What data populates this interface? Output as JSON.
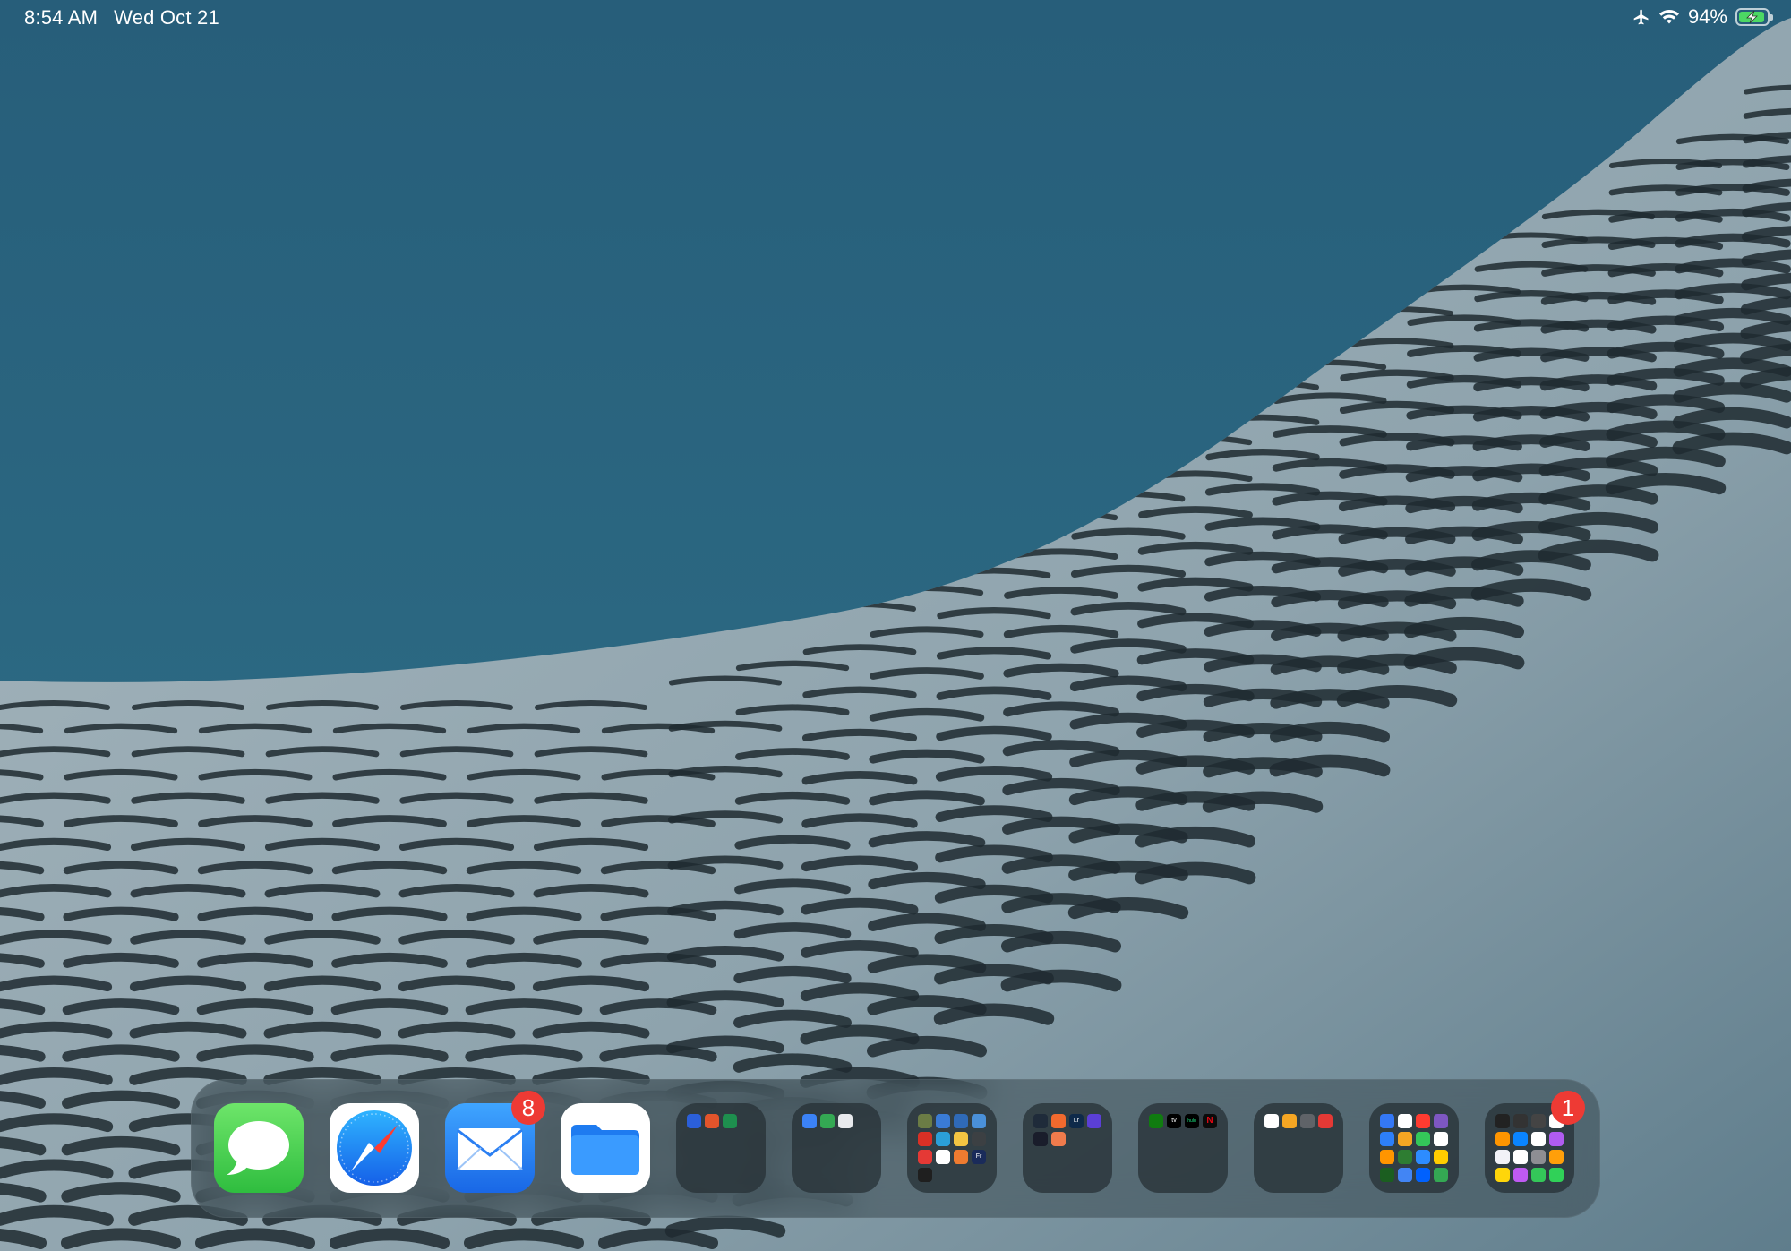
{
  "status_bar": {
    "time": "8:54 AM",
    "date": "Wed Oct 21",
    "battery_percent": "94%",
    "battery_level": 0.94,
    "airplane_icon": "airplane-icon",
    "wifi_icon": "wifi-icon",
    "battery_icon": "battery-charging-icon"
  },
  "dock": {
    "apps": [
      {
        "name": "messages",
        "icon": "messages-icon"
      },
      {
        "name": "safari",
        "icon": "safari-compass-icon"
      },
      {
        "name": "mail",
        "icon": "mail-envelope-icon",
        "badge": "8"
      },
      {
        "name": "files",
        "icon": "files-folder-icon"
      }
    ],
    "folders": [
      {
        "name": "folder-1",
        "mini": [
          {
            "color": "#2b5fd9"
          },
          {
            "color": "#e2542b"
          },
          {
            "color": "#1e8f4e"
          }
        ]
      },
      {
        "name": "folder-2",
        "mini": [
          {
            "color": "#3b82f6"
          },
          {
            "color": "#34a853"
          },
          {
            "color": "#e8eaed"
          }
        ]
      },
      {
        "name": "folder-3",
        "mini": [
          {
            "color": "#6b7c45"
          },
          {
            "color": "#3a7bd5"
          },
          {
            "color": "#2f6ab8"
          },
          {
            "color": "#4a90d9"
          },
          {
            "color": "#d93025"
          },
          {
            "color": "#2b9fd8"
          },
          {
            "color": "#f4c542"
          },
          {
            "color": "#3c4043"
          },
          {
            "color": "#e53935"
          },
          {
            "color": "#ffffff"
          },
          {
            "color": "#ee7b30"
          },
          {
            "color": "#1a2b5a",
            "label": "Fr"
          },
          {
            "color": "#1f1f1f"
          }
        ]
      },
      {
        "name": "folder-4",
        "mini": [
          {
            "color": "#1f2b3a"
          },
          {
            "color": "#f26a2e"
          },
          {
            "color": "#0e2a4a",
            "label": "Lr"
          },
          {
            "color": "#5b3fd6"
          },
          {
            "color": "#1a1d2b"
          },
          {
            "color": "#f07b4c"
          }
        ]
      },
      {
        "name": "folder-5",
        "mini": [
          {
            "color": "#107c10"
          },
          {
            "color": "#000000",
            "label": "tv"
          },
          {
            "color": "#000000",
            "label": "hulu"
          },
          {
            "color": "#0b0b0b",
            "label": "N"
          }
        ]
      },
      {
        "name": "folder-6",
        "mini": [
          {
            "color": "#ffffff"
          },
          {
            "color": "#f5a623"
          },
          {
            "color": "#5f6368"
          },
          {
            "color": "#e53935"
          }
        ]
      },
      {
        "name": "folder-7",
        "mini": [
          {
            "color": "#3478f6"
          },
          {
            "color": "#ffffff"
          },
          {
            "color": "#ff3b30"
          },
          {
            "color": "#7e57c2"
          },
          {
            "color": "#2d7ff9"
          },
          {
            "color": "#f5a623"
          },
          {
            "color": "#34c759"
          },
          {
            "color": "#ffffff"
          },
          {
            "color": "#ff9500"
          },
          {
            "color": "#2e7d32"
          },
          {
            "color": "#2d8cff"
          },
          {
            "color": "#ffcc00"
          },
          {
            "color": "#1b5e20"
          },
          {
            "color": "#4285f4"
          },
          {
            "color": "#0061fe"
          },
          {
            "color": "#34a853"
          }
        ]
      },
      {
        "name": "folder-8",
        "badge": "1",
        "mini": [
          {
            "color": "#222222"
          },
          {
            "color": "#333333"
          },
          {
            "color": "#444444"
          },
          {
            "color": "#ffffff"
          },
          {
            "color": "#ff9500"
          },
          {
            "color": "#0a84ff"
          },
          {
            "color": "#ffffff"
          },
          {
            "color": "#b05cf0"
          },
          {
            "color": "#f2f2f7"
          },
          {
            "color": "#ffffff"
          },
          {
            "color": "#8e8e93"
          },
          {
            "color": "#ff9f0a"
          },
          {
            "color": "#ffd60a"
          },
          {
            "color": "#bf5af2"
          },
          {
            "color": "#34c759"
          },
          {
            "color": "#30d158"
          }
        ]
      }
    ]
  }
}
